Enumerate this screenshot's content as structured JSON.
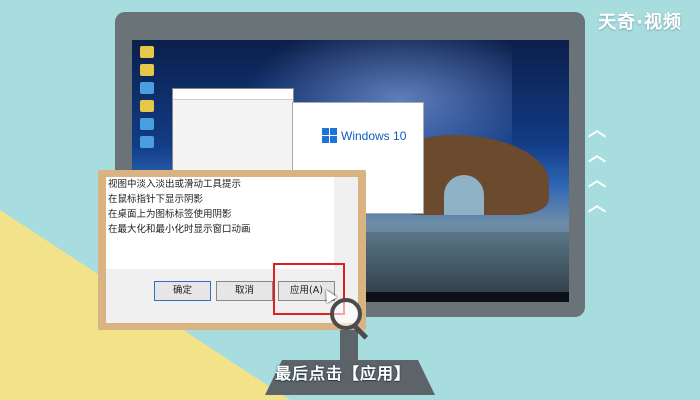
{
  "watermark": {
    "label": "天奇·视频"
  },
  "screen": {
    "windows_badge": "Windows 10"
  },
  "dialog": {
    "options": [
      "视图中淡入淡出或滑动工具提示",
      "在鼠标指针下显示阴影",
      "在桌面上为图标标签使用阴影",
      "在最大化和最小化时显示窗口动画"
    ],
    "buttons": {
      "ok": "确定",
      "cancel": "取消",
      "apply": "应用(A)"
    }
  },
  "caption": {
    "text": "最后点击【应用】"
  },
  "decor": {
    "arrow_icon": "chevron-up-icon",
    "magnifier_icon": "magnifier-icon"
  },
  "colors": {
    "highlight": "#e02020",
    "board_frame": "#d9b382",
    "background": "#a8dde0"
  }
}
